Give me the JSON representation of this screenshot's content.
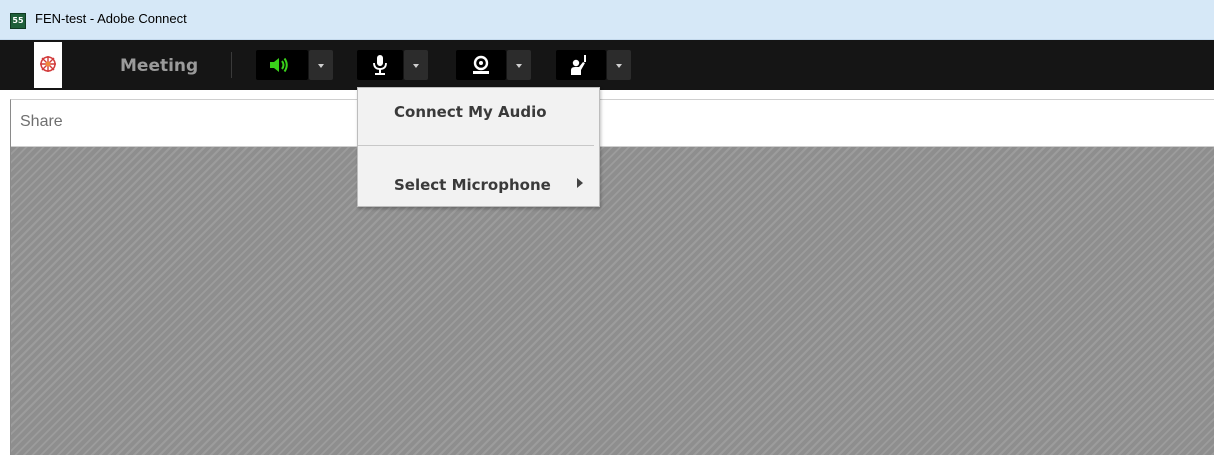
{
  "window": {
    "title": "FEN-test - Adobe Connect",
    "app_icon_text": "55"
  },
  "toolbar": {
    "meeting_menu": "Meeting",
    "buttons": [
      {
        "name": "speaker",
        "icon": "speaker-icon",
        "state": "on",
        "color": "#39d11a"
      },
      {
        "name": "microphone",
        "icon": "microphone-icon",
        "state": "off",
        "color": "#ffffff"
      },
      {
        "name": "camera",
        "icon": "webcam-icon",
        "state": "off",
        "color": "#ffffff"
      },
      {
        "name": "raise-hand",
        "icon": "raise-hand-icon",
        "state": "off",
        "color": "#ffffff"
      }
    ]
  },
  "share_pod": {
    "title": "Share"
  },
  "microphone_menu": {
    "items": [
      {
        "label": "Connect My Audio",
        "has_submenu": false
      },
      {
        "label": "Select Microphone",
        "has_submenu": true
      }
    ]
  },
  "colors": {
    "titlebar": "#d6e8f7",
    "toolbar": "#151515",
    "accent_green": "#39d11a",
    "share_background": "#8e8e8e"
  }
}
